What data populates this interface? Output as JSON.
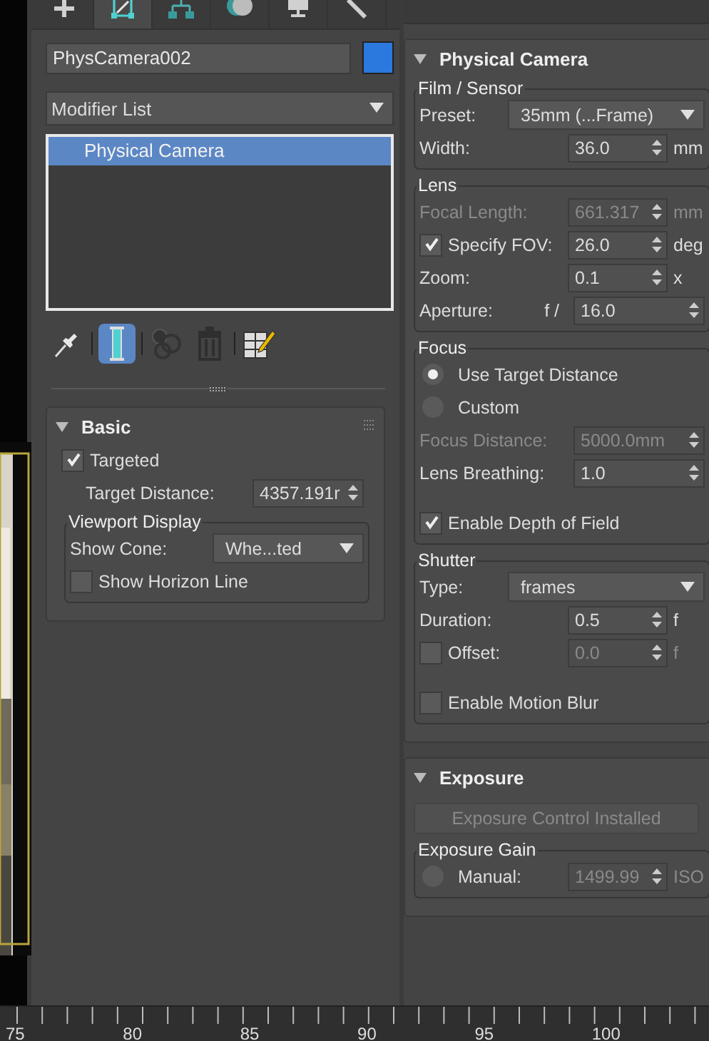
{
  "command_tabs": [
    {
      "kind": "create",
      "selected": false
    },
    {
      "kind": "modify",
      "selected": true
    },
    {
      "kind": "hierarchy",
      "selected": false
    },
    {
      "kind": "motion",
      "selected": false
    },
    {
      "kind": "display",
      "selected": false
    },
    {
      "kind": "utilities",
      "selected": false
    }
  ],
  "object_name": "PhysCamera002",
  "modifier_list": "Modifier List",
  "stack": [
    {
      "label": "Physical Camera",
      "selected": true
    }
  ],
  "stack_tools": [
    {
      "kind": "pin",
      "selected": false
    },
    {
      "kind": "end_result",
      "selected": true
    },
    {
      "kind": "make_unique",
      "selected": false
    },
    {
      "kind": "remove",
      "selected": false
    },
    {
      "kind": "configure",
      "selected": false
    }
  ],
  "left_rollouts": [
    {
      "title": "Basic",
      "expanded": true,
      "items": [
        {
          "kind": "checkbox",
          "label": "Targeted",
          "checked": true
        },
        {
          "kind": "spinner",
          "label": "Target Distance:",
          "value": "4357.191r",
          "indent": true,
          "disabled": false
        },
        {
          "kind": "group",
          "title": "Viewport Display",
          "rows": [
            {
              "kind": "dropdown",
              "label": "Show Cone:",
              "value": "Whe...ted"
            },
            {
              "kind": "checkbox",
              "label": "Show Horizon Line",
              "checked": false
            }
          ]
        }
      ]
    }
  ],
  "right_rollouts": [
    {
      "title": "Physical Camera",
      "expanded": true,
      "items": [
        {
          "kind": "group",
          "title": "Film / Sensor",
          "rows": [
            {
              "kind": "dropdown",
              "label": "Preset:",
              "value": "35mm (...Frame)"
            },
            {
              "kind": "spinner",
              "label": "Width:",
              "value": "36.0",
              "unit": "mm",
              "disabled": false
            }
          ]
        },
        {
          "kind": "group",
          "title": "Lens",
          "rows": [
            {
              "kind": "spinner",
              "label": "Focal Length:",
              "value": "661.317",
              "unit": "mm",
              "disabled": true
            },
            {
              "kind": "spinner",
              "label": "Specify FOV:",
              "value": "26.0",
              "unit": "deg",
              "checked": true,
              "disabled": false
            },
            {
              "kind": "spinner",
              "label": "Zoom:",
              "value": "0.1",
              "unit": "x",
              "disabled": false
            },
            {
              "kind": "spinner",
              "label": "Aperture:",
              "prefix": "f /",
              "value": "16.0",
              "disabled": false
            }
          ]
        },
        {
          "kind": "group",
          "title": "Focus",
          "rows": [
            {
              "kind": "radio",
              "label": "Use Target Distance",
              "selected": true
            },
            {
              "kind": "radio",
              "label": "Custom",
              "selected": false
            },
            {
              "kind": "spinner",
              "label": "Focus Distance:",
              "value": "5000.0mm",
              "disabled": true
            },
            {
              "kind": "spinner",
              "label": "Lens Breathing:",
              "value": "1.0",
              "disabled": false
            },
            {
              "kind": "checkbox",
              "label": "Enable Depth of Field",
              "checked": true
            }
          ]
        },
        {
          "kind": "group",
          "title": "Shutter",
          "rows": [
            {
              "kind": "dropdown",
              "label": "Type:",
              "value": "frames"
            },
            {
              "kind": "spinner",
              "label": "Duration:",
              "value": "0.5",
              "unit": "f",
              "disabled": false
            },
            {
              "kind": "spinner",
              "label": "Offset:",
              "value": "0.0",
              "unit": "f",
              "checked": false,
              "disabled": true
            },
            {
              "kind": "checkbox",
              "label": "Enable Motion Blur",
              "checked": false
            }
          ]
        }
      ]
    },
    {
      "title": "Exposure",
      "expanded": true,
      "items": [
        {
          "kind": "button",
          "label": "Exposure Control Installed",
          "disabled": true
        },
        {
          "kind": "group",
          "title": "Exposure Gain",
          "rows": [
            {
              "kind": "spinner",
              "label": "Manual:",
              "value": "1499.99",
              "unit": "ISO",
              "selected": false,
              "disabled": true
            }
          ]
        }
      ]
    }
  ],
  "timeline": {
    "labels": [
      "75",
      "80",
      "85",
      "90",
      "95",
      "100"
    ]
  }
}
